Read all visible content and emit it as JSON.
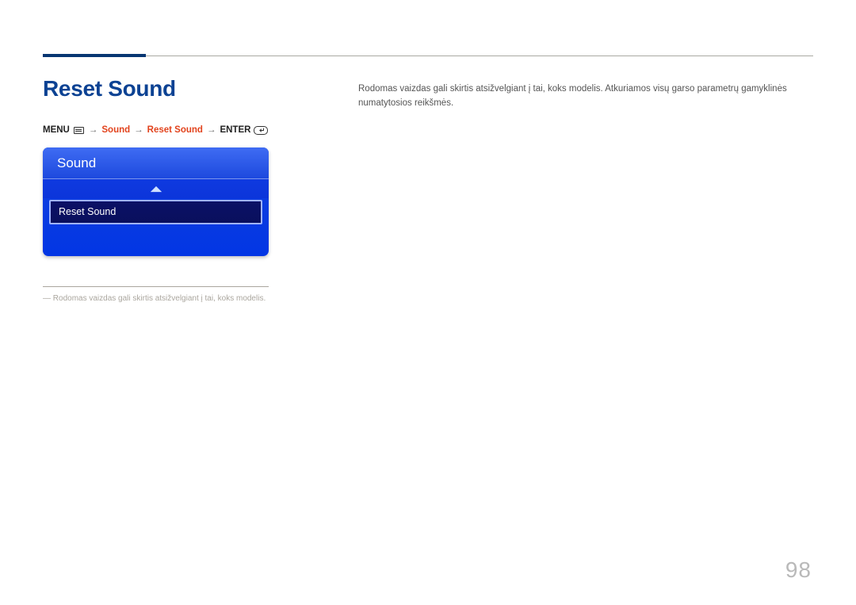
{
  "heading": "Reset Sound",
  "breadcrumb": {
    "menu": "MENU",
    "sound": "Sound",
    "reset_sound": "Reset Sound",
    "enter": "ENTER"
  },
  "osd": {
    "title": "Sound",
    "selected_item": "Reset Sound"
  },
  "footnote": "Rodomas vaizdas gali skirtis atsižvelgiant į tai, koks modelis.",
  "body": "Rodomas vaizdas gali skirtis atsižvelgiant į tai, koks modelis. Atkuriamos visų garso parametrų gamyklinės numatytosios reikšmės.",
  "page_number": "98"
}
